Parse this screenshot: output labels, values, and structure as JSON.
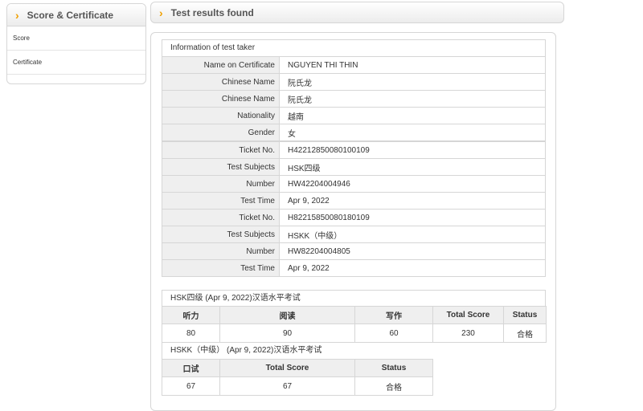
{
  "sidebar": {
    "title": "Score & Certificate",
    "items": [
      {
        "label": "Score"
      },
      {
        "label": "Certificate"
      }
    ]
  },
  "header": {
    "title": "Test results found"
  },
  "info": {
    "title": "Information of test taker",
    "personal": [
      {
        "label": "Name on Certificate",
        "value": "NGUYEN THI THIN"
      },
      {
        "label": "Chinese Name",
        "value": "阮氏龙"
      },
      {
        "label": "Chinese Name",
        "value": "阮氏龙"
      },
      {
        "label": "Nationality",
        "value": "越南"
      },
      {
        "label": "Gender",
        "value": "女"
      }
    ],
    "tests": [
      {
        "label": "Ticket No.",
        "value": "H42212850080100109"
      },
      {
        "label": "Test Subjects",
        "value": "HSK四级"
      },
      {
        "label": "Number",
        "value": "HW42204004946"
      },
      {
        "label": "Test Time",
        "value": "Apr 9, 2022"
      },
      {
        "label": "Ticket No.",
        "value": "H82215850080180109"
      },
      {
        "label": "Test Subjects",
        "value": "HSKK（中级）"
      },
      {
        "label": "Number",
        "value": "HW82204004805"
      },
      {
        "label": "Test Time",
        "value": "Apr 9, 2022"
      }
    ]
  },
  "hsk": {
    "title": "HSK四级 (Apr 9, 2022)汉语水平考试",
    "headers": [
      "听力",
      "阅读",
      "写作",
      "Total Score",
      "Status"
    ],
    "values": [
      "80",
      "90",
      "60",
      "230",
      "合格"
    ]
  },
  "hskk": {
    "title": "HSKK（中级） (Apr 9, 2022)汉语水平考试",
    "headers": [
      "口试",
      "Total Score",
      "Status"
    ],
    "values": [
      "67",
      "67",
      "合格"
    ]
  }
}
